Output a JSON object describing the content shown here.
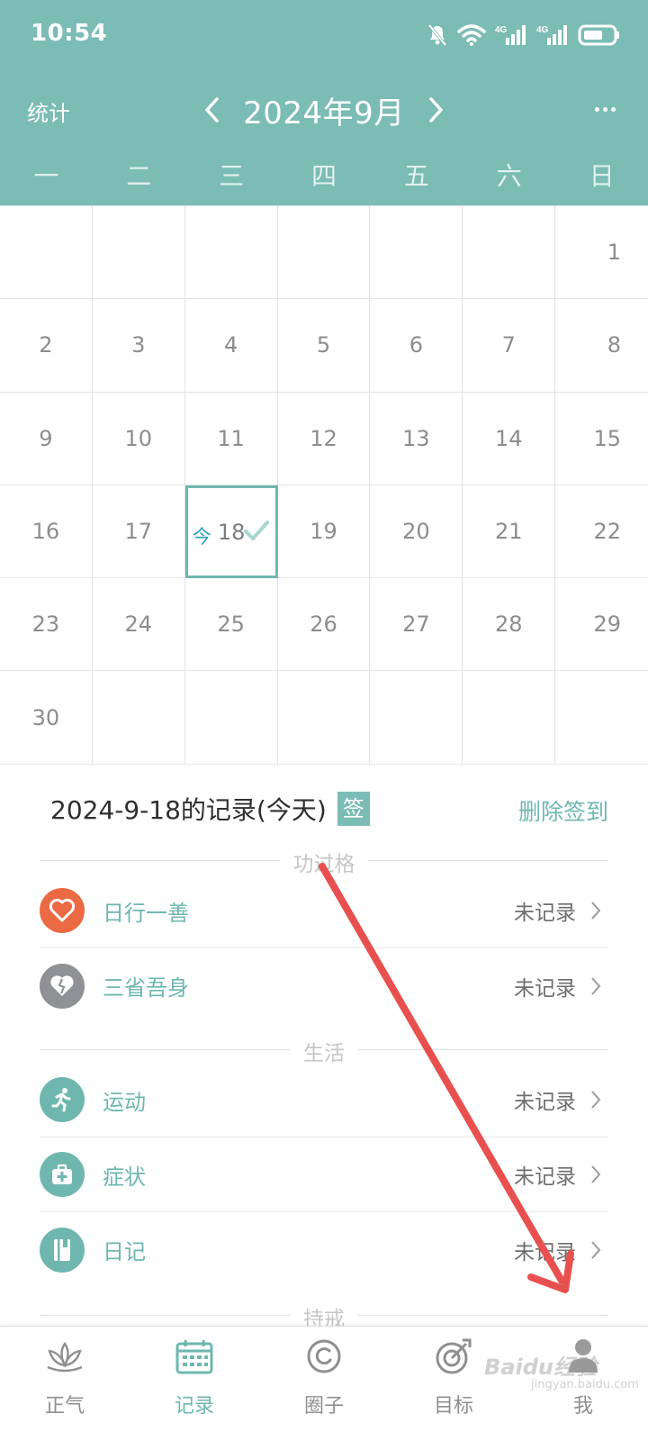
{
  "status_bar": {
    "time": "10:54"
  },
  "header": {
    "stats_label": "统计",
    "month_title": "2024年9月",
    "weekdays": [
      "一",
      "二",
      "三",
      "四",
      "五",
      "六",
      "日"
    ]
  },
  "calendar": {
    "days": [
      "",
      "",
      "",
      "",
      "",
      "",
      "1",
      "2",
      "3",
      "4",
      "5",
      "6",
      "7",
      "8",
      "9",
      "10",
      "11",
      "12",
      "13",
      "14",
      "15",
      "16",
      "17",
      "18",
      "19",
      "20",
      "21",
      "22",
      "23",
      "24",
      "25",
      "26",
      "27",
      "28",
      "29",
      "30",
      "",
      "",
      "",
      "",
      "",
      ""
    ],
    "today": "18",
    "today_tag": "今"
  },
  "records": {
    "title": "2024-9-18的记录(今天)",
    "sign_badge": "签",
    "delete_label": "删除签到",
    "sections": [
      {
        "label": "功过格",
        "items": [
          {
            "label": "日行一善",
            "status": "未记录",
            "icon": "heart-icon",
            "color": "#ec6a43"
          },
          {
            "label": "三省吾身",
            "status": "未记录",
            "icon": "broken-heart-icon",
            "color": "#8f9194"
          }
        ]
      },
      {
        "label": "生活",
        "items": [
          {
            "label": "运动",
            "status": "未记录",
            "icon": "running-icon",
            "color": "#6fb7ae"
          },
          {
            "label": "症状",
            "status": "未记录",
            "icon": "medical-kit-icon",
            "color": "#6fb7ae"
          },
          {
            "label": "日记",
            "status": "未记录",
            "icon": "notebook-icon",
            "color": "#6fb7ae"
          }
        ]
      },
      {
        "label": "持戒",
        "items": []
      }
    ]
  },
  "bottom_nav": {
    "items": [
      {
        "label": "正气",
        "icon": "lotus-icon"
      },
      {
        "label": "记录",
        "icon": "calendar-icon",
        "active": true
      },
      {
        "label": "圈子",
        "icon": "circle-icon"
      },
      {
        "label": "目标",
        "icon": "target-icon"
      },
      {
        "label": "我",
        "icon": "user-icon"
      }
    ]
  },
  "colors": {
    "brand": "#7bbcb5",
    "accent_text": "#6eb7ae",
    "annotation_arrow": "#e8504f"
  },
  "watermark": {
    "text": "Baidu经验",
    "sub": "jingyan.baidu.com"
  }
}
